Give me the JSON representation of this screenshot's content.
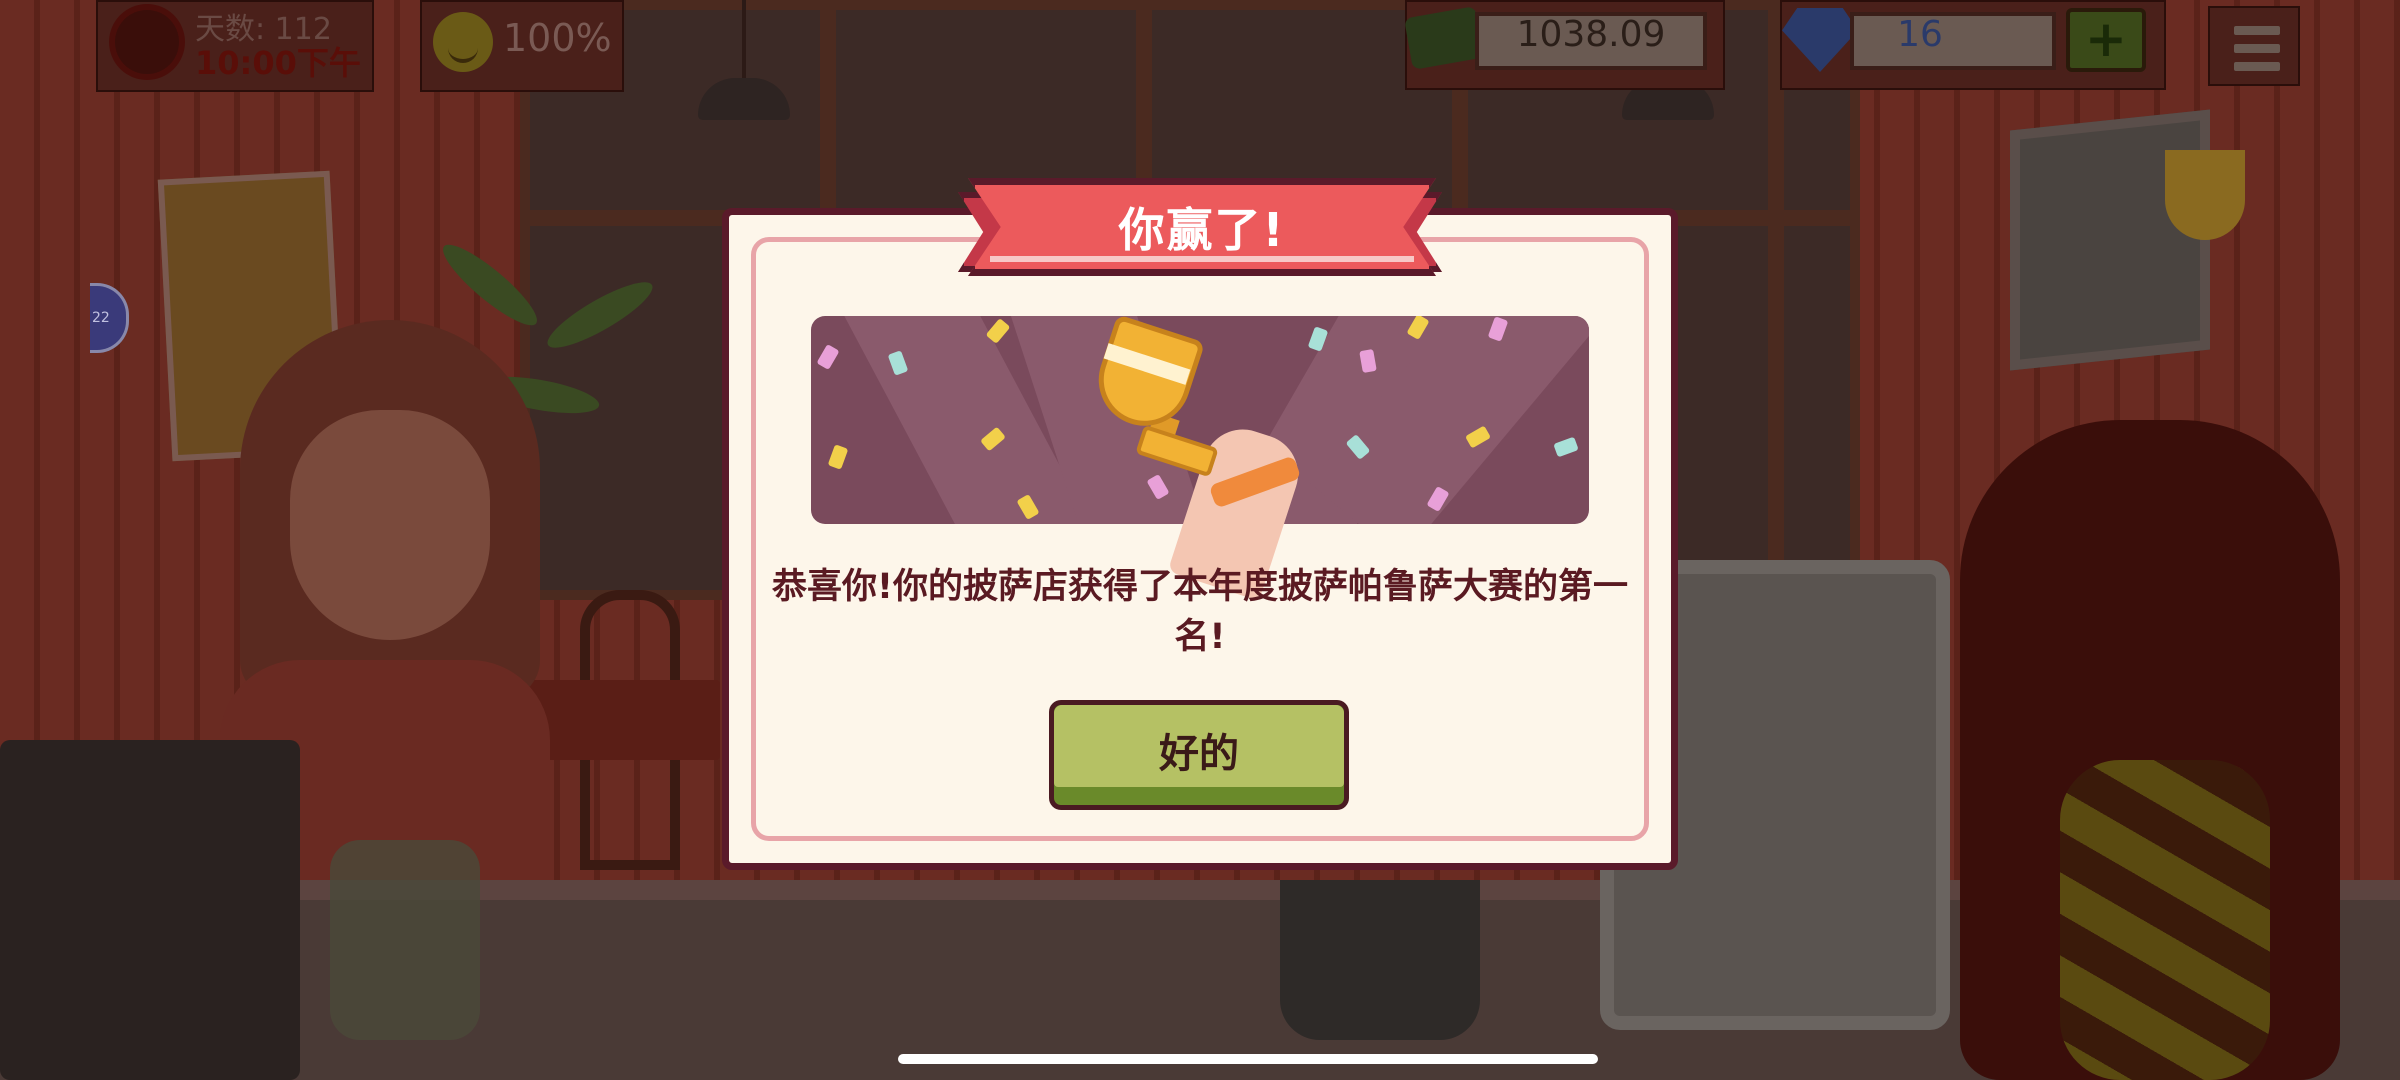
{
  "hud": {
    "days_label": "天数: 112",
    "time_label": "10:00下午",
    "happiness": "100%",
    "money": "1038.09",
    "gems": "16",
    "add_gems_label": "+",
    "side_badge": "22"
  },
  "dialog": {
    "title": "你赢了!",
    "message": "恭喜你!你的披萨店获得了本年度披萨帕鲁萨大赛的第一名!",
    "ok_label": "好的"
  },
  "colors": {
    "ribbon": "#ec5a5c",
    "dialog_bg": "#fdf6ea",
    "dialog_border": "#5a1a2a",
    "button": "#b5c164",
    "trophy": "#f2b234"
  },
  "icons": [
    "sun-icon",
    "smiley-icon",
    "cash-icon",
    "gem-icon",
    "plus-icon",
    "menu-icon",
    "trophy-icon"
  ]
}
